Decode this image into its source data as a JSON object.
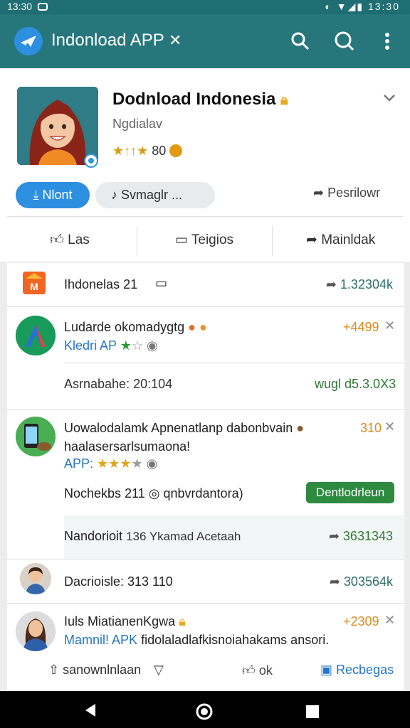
{
  "statusbar": {
    "time_left": "13:30",
    "time_right": "13:30"
  },
  "appbar": {
    "title": "Indonload APP"
  },
  "header": {
    "title": "Dodnload Indonesia",
    "subtitle": "Ngdialav",
    "rating": "80",
    "primary_button": "Nlont",
    "secondary_button": "Svmaglr ...",
    "report_label": "Pesrilowr"
  },
  "actions": {
    "like": "Las",
    "comment": "Teigios",
    "share": "Mainldak"
  },
  "list": {
    "row1": {
      "title": "Ihdonelas 21",
      "value": "1.32304k"
    },
    "row2": {
      "title": "Ludarde okomadygtg",
      "tag": "Kledri AP",
      "delta": "+4499",
      "sub_left": "Asrnabahe: 20:104",
      "sub_right": "wugl d5.3.0X3"
    },
    "row3": {
      "title": "Uowalodalamk Apnenatlanp dabonbvain",
      "title2": "haalasersarlsumaona!",
      "tag": "APP:",
      "delta": "310",
      "meta": "Nochekbs 211",
      "meta2": "qnbvrdantora)",
      "button": "Dentlodrleun",
      "sub_left": "Nandorioit",
      "sub_mid": "136 Ykamad Acetaah",
      "sub_right": "3631343"
    },
    "row4": {
      "title": "Dacrioisle: 313 110",
      "value": "303564k"
    },
    "row5": {
      "title": "Iuls MiatianenKgwa",
      "sub": "Mamnil! APK",
      "sub2": "fidolaladlafkisnoiahakams ansori.",
      "delta": "+2309"
    }
  },
  "bottom_actions": {
    "download": "sanownlnlaan",
    "ok": "ok",
    "share": "Recbegas"
  },
  "colors": {
    "appbar": "#26767b",
    "accent_blue": "#2c8fe0",
    "download_green": "#2d8a3f",
    "delta_orange": "#e08a1c"
  }
}
